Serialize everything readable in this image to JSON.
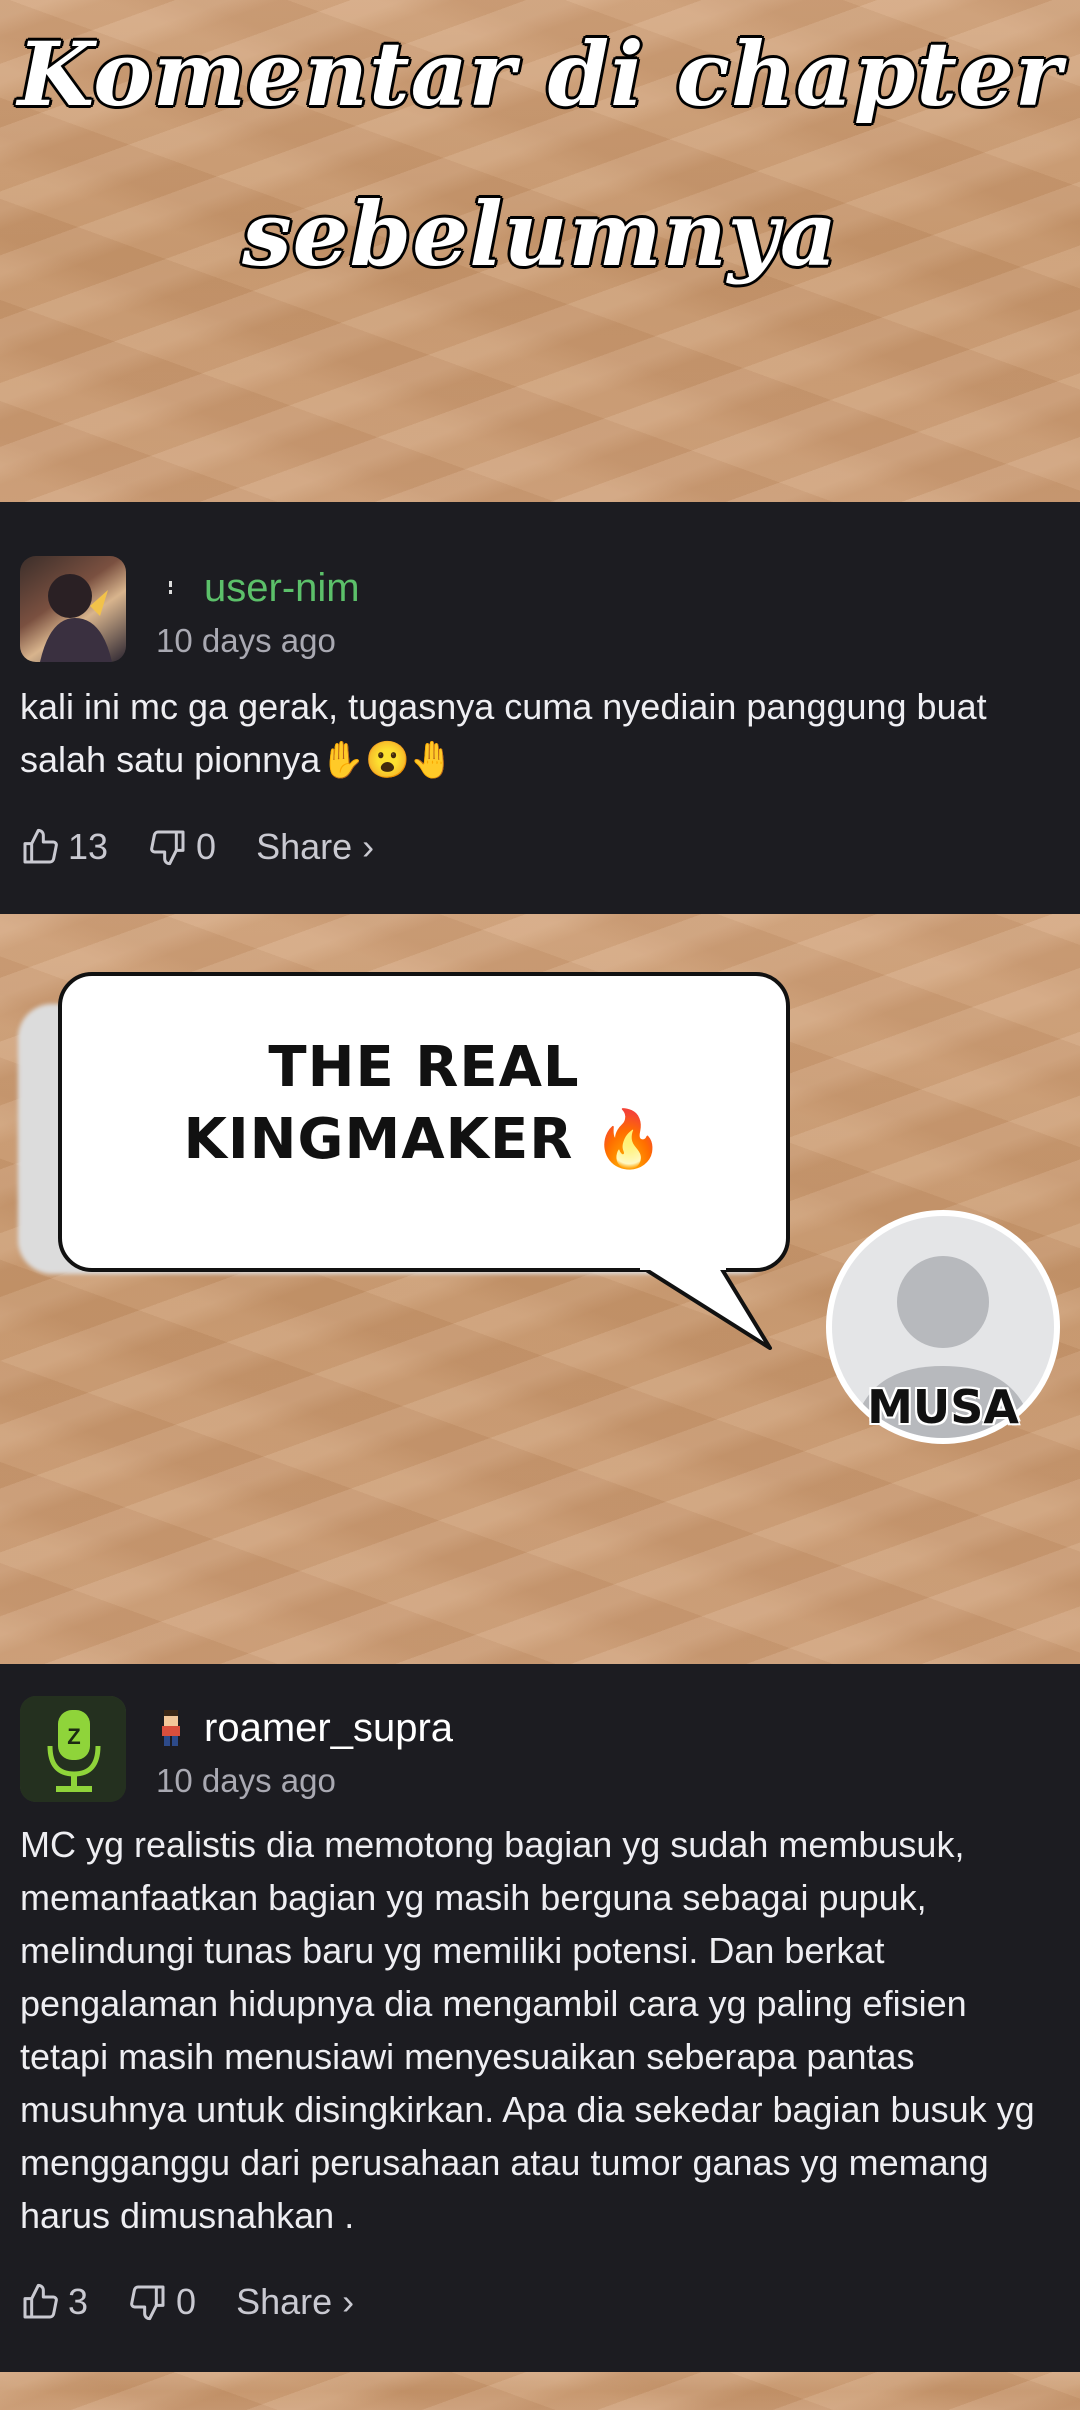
{
  "header": {
    "title_line_1": "Komentar di chapter",
    "title_line_2": "sebelumnya"
  },
  "comments": [
    {
      "username": "user-nim",
      "username_color": "#5cc06a",
      "badge_icon": "dot-badge-icon",
      "time": "10 days ago",
      "text": "kali ini mc ga gerak, tugasnya cuma nyediain panggung buat salah satu pionnya✋😮🤚",
      "likes": "13",
      "dislikes": "0",
      "share_label": "Share ›"
    },
    {
      "username": "roamer_supra",
      "username_color": "#ffffff",
      "badge_icon": "pixel-character-badge-icon",
      "time": "10 days ago",
      "text": "MC yg realistis dia memotong bagian yg sudah membusuk, memanfaatkan bagian yg masih berguna sebagai pupuk, melindungi tunas baru yg memiliki potensi. Dan berkat pengalaman hidupnya dia mengambil cara yg paling efisien tetapi masih menusiawi menyesuaikan seberapa pantas musuhnya untuk disingkirkan. Apa dia sekedar bagian busuk yg mengganggu dari perusahaan atau tumor ganas yg memang harus dimusnahkan .",
      "likes": "3",
      "dislikes": "0",
      "share_label": "Share ›"
    }
  ],
  "speech_bubble": {
    "line_1": "THE REAL",
    "line_2": "KINGMAKER 🔥",
    "speaker": "MUSA"
  }
}
